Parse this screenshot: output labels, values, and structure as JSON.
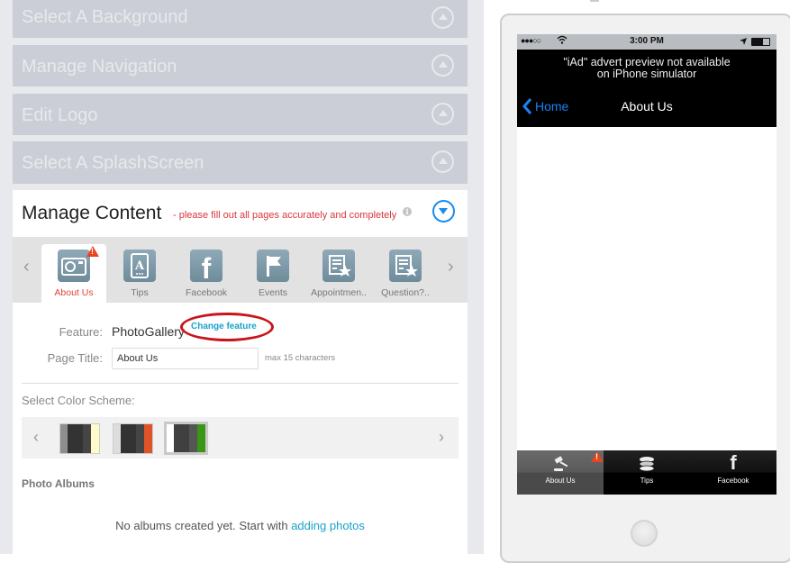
{
  "accordion": [
    {
      "label": "Select A Background"
    },
    {
      "label": "Manage Navigation"
    },
    {
      "label": "Edit Logo"
    },
    {
      "label": "Select A SplashScreen"
    }
  ],
  "manage_content": {
    "title": "Manage Content",
    "note": "- please fill out all pages accurately and completely",
    "info_icon": "i",
    "tabs": [
      {
        "label": "About Us",
        "icon": "camera-icon",
        "active": true,
        "warning": true
      },
      {
        "label": "Tips",
        "icon": "tablet-a-icon"
      },
      {
        "label": "Facebook",
        "icon": "facebook-icon"
      },
      {
        "label": "Events",
        "icon": "flag-icon"
      },
      {
        "label": "Appointmen..",
        "icon": "form-star-icon"
      },
      {
        "label": "Question?..",
        "icon": "form-star-icon"
      }
    ],
    "feature_label": "Feature:",
    "feature_value": "PhotoGallery",
    "change_feature": "Change feature",
    "page_title_label": "Page Title:",
    "page_title_value": "About Us",
    "max_chars": "max 15 characters",
    "color_scheme_label": "Select Color Scheme:",
    "color_schemes": [
      {
        "colors": [
          "#8e8e8e",
          "#333333",
          "#454545",
          "#fffccc"
        ]
      },
      {
        "colors": [
          "#dddddd",
          "#333333",
          "#454545",
          "#e05428"
        ],
        "selected": false
      },
      {
        "colors": [
          "#ffffff",
          "#404040",
          "#555555",
          "#3a9614"
        ],
        "selected": true
      }
    ],
    "photo_albums_label": "Photo Albums",
    "no_albums_text": "No albums created yet. Start with ",
    "adding_photos_link": "adding photos"
  },
  "phone": {
    "signal": "●●●○○",
    "time": "3:00 PM",
    "ad_line1": "\"iAd\" advert preview not available",
    "ad_line2": "on iPhone simulator",
    "back_label": "Home",
    "nav_title": "About Us",
    "tabs": [
      {
        "label": "About Us",
        "icon": "gavel-icon",
        "active": true,
        "warning": true
      },
      {
        "label": "Tips",
        "icon": "coins-icon"
      },
      {
        "label": "Facebook",
        "icon": "facebook-icon"
      }
    ]
  }
}
